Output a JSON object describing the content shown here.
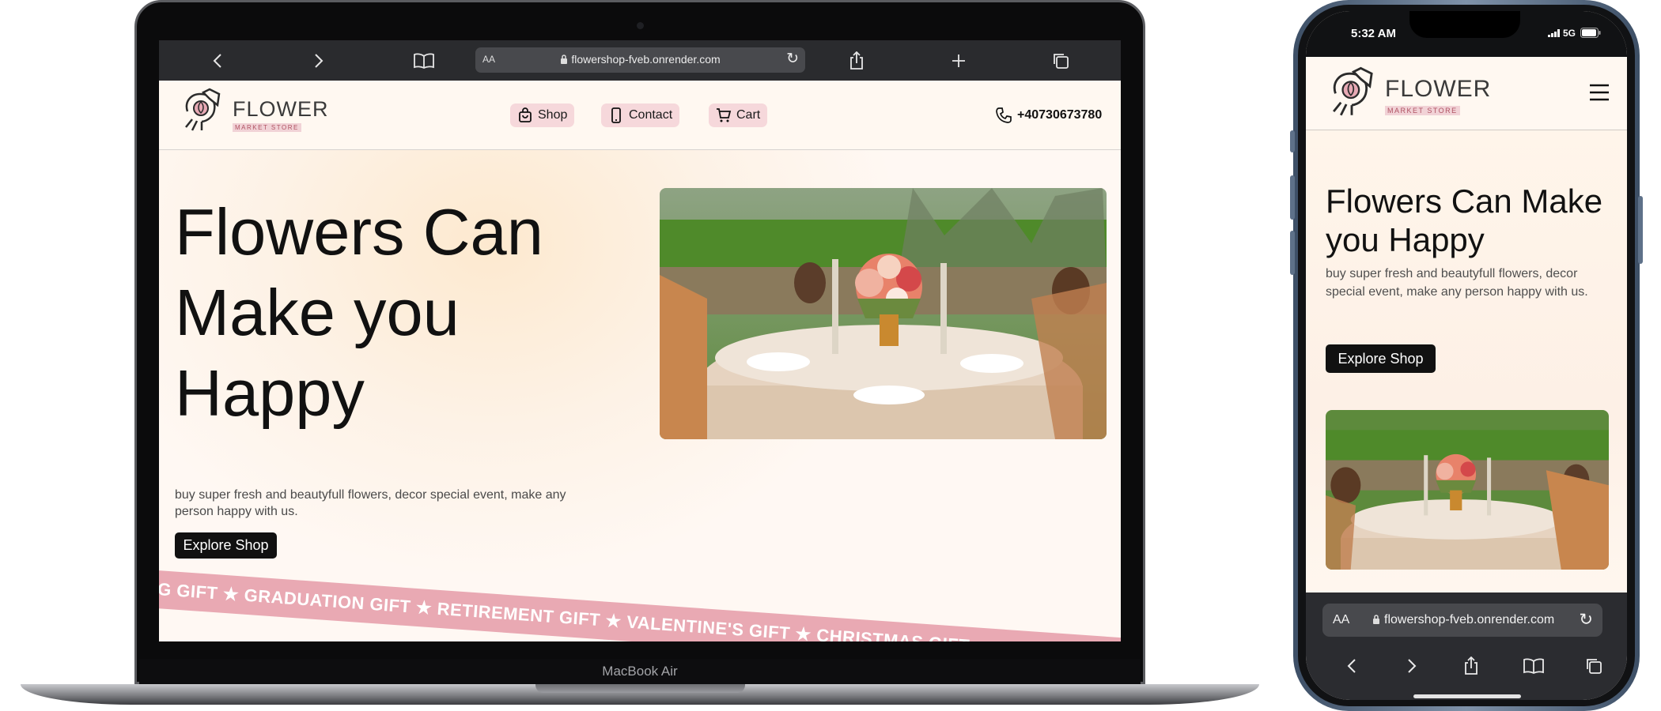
{
  "laptop": {
    "model_label": "MacBook Air",
    "browser": {
      "back_icon": "chevron-left-icon",
      "forward_icon": "chevron-right-icon",
      "bookmarks_icon": "book-icon",
      "text_size_label": "AA",
      "url": "flowershop-fveb.onrender.com",
      "reload_icon": "reload-icon",
      "share_icon": "share-icon",
      "new_tab_icon": "plus-icon",
      "tabs_icon": "tabs-icon"
    }
  },
  "site": {
    "logo": {
      "title": "FLOWER",
      "subtitle": "MARKET STORE"
    },
    "nav": [
      {
        "label": "Shop",
        "icon": "bag-icon"
      },
      {
        "label": "Contact",
        "icon": "phone-device-icon"
      },
      {
        "label": "Cart",
        "icon": "cart-icon"
      }
    ],
    "phone": "+40730673780",
    "hero": {
      "title": "Flowers Can Make you Happy",
      "text": "buy super fresh and beautyfull flowers, decor special event, make any person happy with us.",
      "cta": "Explore Shop",
      "image_alt": "Outdoor wedding table setting with flower centerpiece in a vineyard"
    },
    "ribbon": "G GIFT ★ GRADUATION GIFT ★ RETIREMENT GIFT ★ VALENTINE'S GIFT ★ CHRISTMAS GIFT"
  },
  "phone_device": {
    "time": "5:32 AM",
    "network": "5G",
    "text_size_label": "AA",
    "url": "flowershop-fveb.onrender.com",
    "menu_icon": "hamburger-menu-icon"
  },
  "colors": {
    "accent_pink": "#f6d8db",
    "ribbon_pink": "#e9a9b3",
    "cta_dark": "#111111",
    "page_bg": "#fff8f1"
  }
}
